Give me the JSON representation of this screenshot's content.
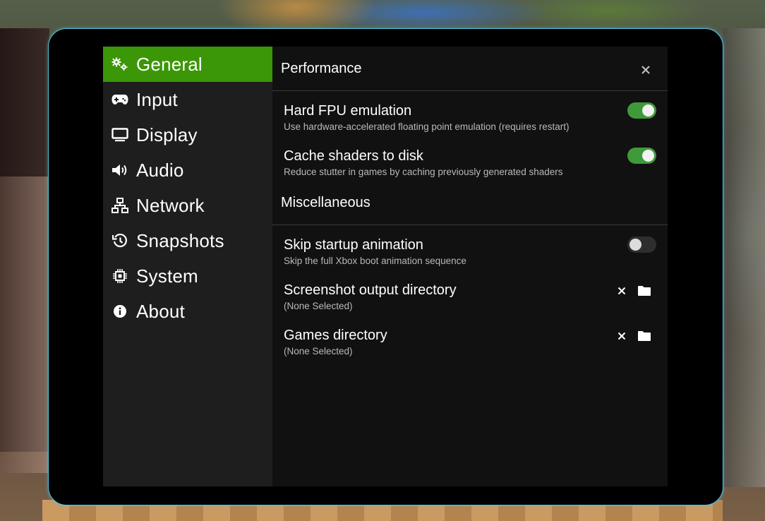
{
  "sidebar": {
    "items": [
      {
        "label": "General",
        "icon": "gears-icon",
        "active": true
      },
      {
        "label": "Input",
        "icon": "gamepad-icon"
      },
      {
        "label": "Display",
        "icon": "monitor-icon"
      },
      {
        "label": "Audio",
        "icon": "speaker-icon"
      },
      {
        "label": "Network",
        "icon": "network-icon"
      },
      {
        "label": "Snapshots",
        "icon": "history-icon"
      },
      {
        "label": "System",
        "icon": "chip-icon"
      },
      {
        "label": "About",
        "icon": "info-icon"
      }
    ]
  },
  "colors": {
    "accent": "#3b9608",
    "toggle_on": "#3f9a3a",
    "frame": "#55c3e0"
  },
  "sections": {
    "performance": {
      "title": "Performance",
      "settings": [
        {
          "title": "Hard FPU emulation",
          "desc": "Use hardware-accelerated floating point emulation (requires restart)",
          "enabled": true
        },
        {
          "title": "Cache shaders to disk",
          "desc": "Reduce stutter in games by caching previously generated shaders",
          "enabled": true
        }
      ]
    },
    "misc": {
      "title": "Miscellaneous",
      "settings": [
        {
          "title": "Skip startup animation",
          "desc": "Skip the full Xbox boot animation sequence",
          "enabled": false
        },
        {
          "title": "Screenshot output directory",
          "desc": "(None Selected)"
        },
        {
          "title": "Games directory",
          "desc": "(None Selected)"
        }
      ]
    }
  }
}
